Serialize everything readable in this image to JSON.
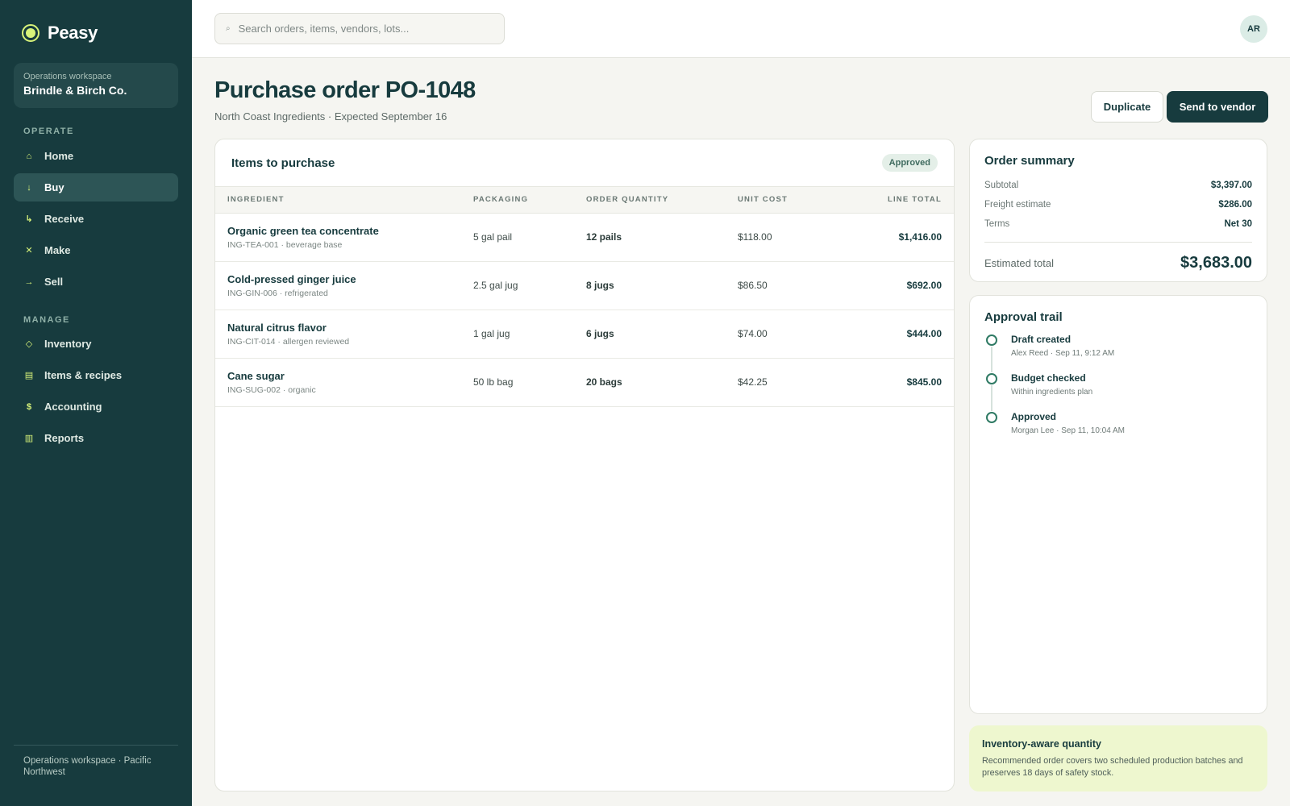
{
  "app": {
    "brand": "Peasy",
    "workspace_label": "Operations workspace",
    "workspace_name": "Brindle & Birch Co.",
    "footer": "Operations workspace · Pacific Northwest"
  },
  "sidebar": {
    "operate_label": "OPERATE",
    "operate_items": [
      {
        "label": "Home",
        "icon": "⌂",
        "icon_name": "home-icon"
      },
      {
        "label": "Buy",
        "icon": "↓",
        "icon_name": "buy-arrow-icon",
        "active": true
      },
      {
        "label": "Receive",
        "icon": "↳",
        "icon_name": "receive-icon"
      },
      {
        "label": "Make",
        "icon": "✕",
        "icon_name": "make-icon"
      },
      {
        "label": "Sell",
        "icon": "→",
        "icon_name": "sell-arrow-icon"
      }
    ],
    "manage_label": "MANAGE",
    "manage_items": [
      {
        "label": "Inventory",
        "icon": "◇",
        "icon_name": "inventory-icon"
      },
      {
        "label": "Items & recipes",
        "icon": "▤",
        "icon_name": "recipes-icon"
      },
      {
        "label": "Accounting",
        "icon": "$",
        "icon_name": "accounting-icon"
      },
      {
        "label": "Reports",
        "icon": "▥",
        "icon_name": "reports-icon"
      }
    ]
  },
  "topbar": {
    "search_placeholder": "Search orders, items, vendors, lots...",
    "avatar_initials": "AR"
  },
  "page": {
    "title": "Purchase order PO-1048",
    "subtitle": "North Coast Ingredients · Expected September 16",
    "duplicate_label": "Duplicate",
    "send_label": "Send to vendor"
  },
  "items": {
    "title": "Items to purchase",
    "status": "Approved",
    "columns": [
      "INGREDIENT",
      "PACKAGING",
      "ORDER QUANTITY",
      "UNIT COST",
      "LINE TOTAL"
    ],
    "rows": [
      {
        "name": "Organic green tea concentrate",
        "meta": "ING-TEA-001 · beverage base",
        "packaging": "5 gal pail",
        "quantity": "12 pails",
        "unit_cost": "$118.00",
        "line_total": "$1,416.00"
      },
      {
        "name": "Cold-pressed ginger juice",
        "meta": "ING-GIN-006 · refrigerated",
        "packaging": "2.5 gal jug",
        "quantity": "8 jugs",
        "unit_cost": "$86.50",
        "line_total": "$692.00"
      },
      {
        "name": "Natural citrus flavor",
        "meta": "ING-CIT-014 · allergen reviewed",
        "packaging": "1 gal jug",
        "quantity": "6 jugs",
        "unit_cost": "$74.00",
        "line_total": "$444.00"
      },
      {
        "name": "Cane sugar",
        "meta": "ING-SUG-002 · organic",
        "packaging": "50 lb bag",
        "quantity": "20 bags",
        "unit_cost": "$42.25",
        "line_total": "$845.00"
      }
    ]
  },
  "summary": {
    "title": "Order summary",
    "rows": [
      {
        "label": "Subtotal",
        "value": "$3,397.00"
      },
      {
        "label": "Freight estimate",
        "value": "$286.00"
      },
      {
        "label": "Terms",
        "value": "Net 30"
      }
    ],
    "total_label": "Estimated total",
    "total_value": "$3,683.00"
  },
  "approval": {
    "title": "Approval trail",
    "steps": [
      {
        "title": "Draft created",
        "meta": "Alex Reed · Sep 11, 9:12 AM"
      },
      {
        "title": "Budget checked",
        "meta": "Within ingredients plan"
      },
      {
        "title": "Approved",
        "meta": "Morgan Lee · Sep 11, 10:04 AM"
      }
    ]
  },
  "tip": {
    "title": "Inventory-aware quantity",
    "text": "Recommended order covers two scheduled production batches and preserves 18 days of safety stock."
  },
  "colors": {
    "sidebar": "#173b3e",
    "accent": "#d8f37a",
    "primary_button": "#173b3e",
    "tip_background": "#eef7cf"
  }
}
